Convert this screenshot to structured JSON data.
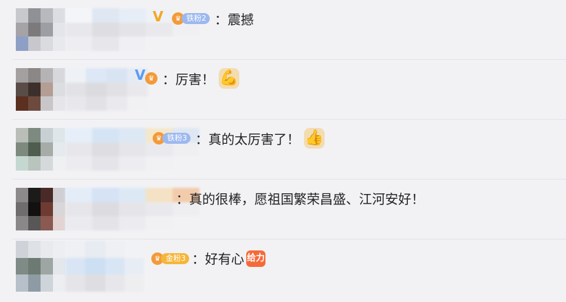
{
  "comments": [
    {
      "colon": "：",
      "text": "震撼",
      "badge": {
        "label": "铁粉2",
        "color": "#9cb8ef",
        "emblem": "#f39a3a"
      },
      "has_v": true
    },
    {
      "colon": "：",
      "text": "厉害！",
      "badge": {
        "label": "",
        "color": "#f39a3a",
        "emblem": "#f39a3a"
      },
      "has_v": true,
      "emoji": "muscle-emoji"
    },
    {
      "colon": "：",
      "text": "真的太厉害了！",
      "badge": {
        "label": "铁粉3",
        "color": "#9cb8ef",
        "emblem": "#f39a3a"
      },
      "has_v": false,
      "emoji": "thumbs-up-emoji"
    },
    {
      "colon": "：",
      "text": "真的很棒，愿祖国繁荣昌盛、江河安好！",
      "badge": null,
      "has_v": false
    },
    {
      "colon": "：",
      "text": "好有心",
      "badge": {
        "label": "金粉3",
        "color": "#f6b63a",
        "emblem": "#f39a3a"
      },
      "has_v": false,
      "sticker": "给力"
    }
  ],
  "colors": {
    "background": "#f2f2f5",
    "separator": "#e3e3e8",
    "text": "#222222",
    "iron_fan_badge": "#9cb8ef",
    "gold_fan_badge": "#f6b63a"
  }
}
